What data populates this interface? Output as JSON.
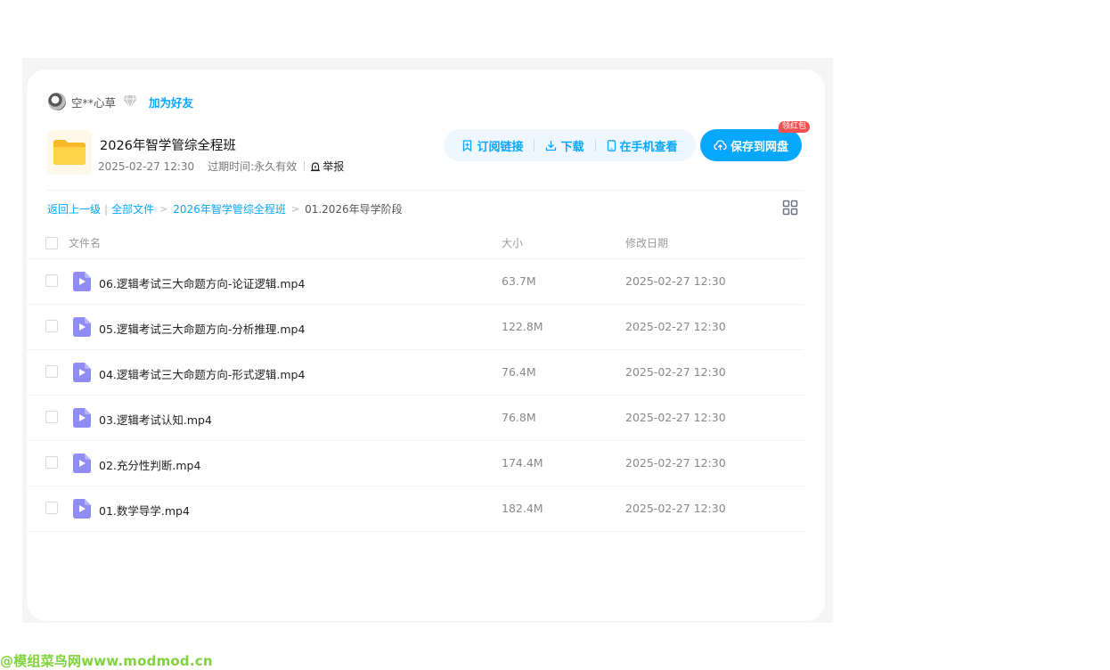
{
  "user": {
    "name": "空**心草",
    "add_friend_label": "加为好友"
  },
  "share": {
    "title": "2026年智学管综全程班",
    "date": "2025-02-27 12:30",
    "expiry_label": "过期时间:",
    "expiry_value": "永久有效",
    "report_label": "举报"
  },
  "actions": {
    "subscribe_label": "订阅链接",
    "download_label": "下载",
    "mobile_label": "在手机查看",
    "save_label": "保存到网盘",
    "badge_label": "领红包"
  },
  "breadcrumb": {
    "back_label": "返回上一级",
    "all_files_label": "全部文件",
    "level1": "2026年智学管综全程班",
    "current": "01.2026年导学阶段"
  },
  "table": {
    "col_name": "文件名",
    "col_size": "大小",
    "col_date": "修改日期",
    "rows": [
      {
        "name": "06.逻辑考试三大命题方向-论证逻辑.mp4",
        "size": "63.7M",
        "date": "2025-02-27 12:30"
      },
      {
        "name": "05.逻辑考试三大命题方向-分析推理.mp4",
        "size": "122.8M",
        "date": "2025-02-27 12:30"
      },
      {
        "name": "04.逻辑考试三大命题方向-形式逻辑.mp4",
        "size": "76.4M",
        "date": "2025-02-27 12:30"
      },
      {
        "name": "03.逻辑考试认知.mp4",
        "size": "76.8M",
        "date": "2025-02-27 12:30"
      },
      {
        "name": "02.充分性判断.mp4",
        "size": "174.4M",
        "date": "2025-02-27 12:30"
      },
      {
        "name": "01.数学导学.mp4",
        "size": "182.4M",
        "date": "2025-02-27 12:30"
      }
    ]
  },
  "icons": {
    "video": "video-file-icon",
    "folder": "folder-icon",
    "grid": "grid-view-icon"
  },
  "colors": {
    "accent": "#06a7ff",
    "badge": "#f3514f",
    "video_icon": "#8f8cf5"
  },
  "watermark": "@模组菜鸟网www.modmod.cn"
}
